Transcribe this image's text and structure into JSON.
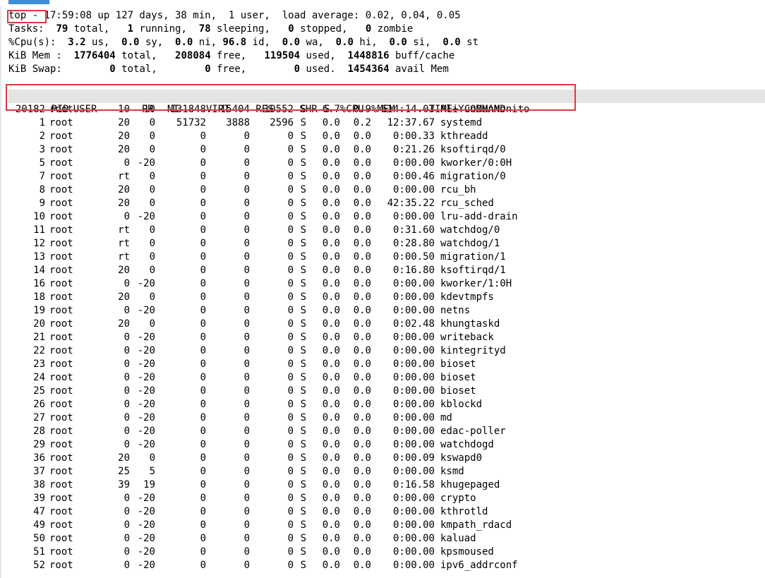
{
  "summary": {
    "l1": [
      "top - 17:59:08 up 127 days, 38 min,  1 user,  load average: 0.02, 0.04, 0.05"
    ],
    "tasks": {
      "label": "Tasks:",
      "total": "79",
      "total_l": " total,",
      "running": "1",
      "running_l": " running,",
      "sleeping": "78",
      "sleeping_l": " sleeping,",
      "stopped": "0",
      "stopped_l": " stopped,",
      "zombie": "0",
      "zombie_l": " zombie"
    },
    "cpu": {
      "label": "%Cpu(s):",
      "us": "3.2",
      "us_l": " us,",
      "sy": "0.0",
      "sy_l": " sy,",
      "ni": "0.0",
      "ni_l": " ni,",
      "id": "96.8",
      "id_l": " id,",
      "wa": "0.0",
      "wa_l": " wa,",
      "hi": "0.0",
      "hi_l": " hi,",
      "si": "0.0",
      "si_l": " si,",
      "st": "0.0",
      "st_l": " st"
    },
    "mem": {
      "label": "KiB Mem :",
      "total": "1776404",
      "total_l": " total,",
      "free": "208084",
      "free_l": " free,",
      "used": "119504",
      "used_l": " used,",
      "buff": "1448816",
      "buff_l": " buff/cache"
    },
    "swap": {
      "label": "KiB Swap:",
      "total": "0",
      "total_l": " total,",
      "free": "0",
      "free_l": " free,",
      "used": "0",
      "used_l": " used.",
      "avail": "1454364",
      "avail_l": " avail Mem"
    }
  },
  "columns": [
    "PID",
    "USER",
    "PR",
    "NI",
    "VIRT",
    "RES",
    "SHR",
    "S",
    "%CPU",
    "%MEM",
    "TIME+",
    "COMMAND"
  ],
  "processes": [
    [
      "20182",
      "root",
      "10",
      "10",
      "131848",
      "15404",
      "10552",
      "S",
      "6.7",
      "0.9",
      "614:14.03",
      "AliYunDunMonito"
    ],
    [
      "1",
      "root",
      "20",
      "0",
      "51732",
      "3888",
      "2596",
      "S",
      "0.0",
      "0.2",
      "12:37.67",
      "systemd"
    ],
    [
      "2",
      "root",
      "20",
      "0",
      "0",
      "0",
      "0",
      "S",
      "0.0",
      "0.0",
      "0:00.33",
      "kthreadd"
    ],
    [
      "3",
      "root",
      "20",
      "0",
      "0",
      "0",
      "0",
      "S",
      "0.0",
      "0.0",
      "0:21.26",
      "ksoftirqd/0"
    ],
    [
      "5",
      "root",
      "0",
      "-20",
      "0",
      "0",
      "0",
      "S",
      "0.0",
      "0.0",
      "0:00.00",
      "kworker/0:0H"
    ],
    [
      "7",
      "root",
      "rt",
      "0",
      "0",
      "0",
      "0",
      "S",
      "0.0",
      "0.0",
      "0:00.46",
      "migration/0"
    ],
    [
      "8",
      "root",
      "20",
      "0",
      "0",
      "0",
      "0",
      "S",
      "0.0",
      "0.0",
      "0:00.00",
      "rcu_bh"
    ],
    [
      "9",
      "root",
      "20",
      "0",
      "0",
      "0",
      "0",
      "S",
      "0.0",
      "0.0",
      "42:35.22",
      "rcu_sched"
    ],
    [
      "10",
      "root",
      "0",
      "-20",
      "0",
      "0",
      "0",
      "S",
      "0.0",
      "0.0",
      "0:00.00",
      "lru-add-drain"
    ],
    [
      "11",
      "root",
      "rt",
      "0",
      "0",
      "0",
      "0",
      "S",
      "0.0",
      "0.0",
      "0:31.60",
      "watchdog/0"
    ],
    [
      "12",
      "root",
      "rt",
      "0",
      "0",
      "0",
      "0",
      "S",
      "0.0",
      "0.0",
      "0:28.80",
      "watchdog/1"
    ],
    [
      "13",
      "root",
      "rt",
      "0",
      "0",
      "0",
      "0",
      "S",
      "0.0",
      "0.0",
      "0:00.50",
      "migration/1"
    ],
    [
      "14",
      "root",
      "20",
      "0",
      "0",
      "0",
      "0",
      "S",
      "0.0",
      "0.0",
      "0:16.80",
      "ksoftirqd/1"
    ],
    [
      "16",
      "root",
      "0",
      "-20",
      "0",
      "0",
      "0",
      "S",
      "0.0",
      "0.0",
      "0:00.00",
      "kworker/1:0H"
    ],
    [
      "18",
      "root",
      "20",
      "0",
      "0",
      "0",
      "0",
      "S",
      "0.0",
      "0.0",
      "0:00.00",
      "kdevtmpfs"
    ],
    [
      "19",
      "root",
      "0",
      "-20",
      "0",
      "0",
      "0",
      "S",
      "0.0",
      "0.0",
      "0:00.00",
      "netns"
    ],
    [
      "20",
      "root",
      "20",
      "0",
      "0",
      "0",
      "0",
      "S",
      "0.0",
      "0.0",
      "0:02.48",
      "khungtaskd"
    ],
    [
      "21",
      "root",
      "0",
      "-20",
      "0",
      "0",
      "0",
      "S",
      "0.0",
      "0.0",
      "0:00.00",
      "writeback"
    ],
    [
      "22",
      "root",
      "0",
      "-20",
      "0",
      "0",
      "0",
      "S",
      "0.0",
      "0.0",
      "0:00.00",
      "kintegrityd"
    ],
    [
      "23",
      "root",
      "0",
      "-20",
      "0",
      "0",
      "0",
      "S",
      "0.0",
      "0.0",
      "0:00.00",
      "bioset"
    ],
    [
      "24",
      "root",
      "0",
      "-20",
      "0",
      "0",
      "0",
      "S",
      "0.0",
      "0.0",
      "0:00.00",
      "bioset"
    ],
    [
      "25",
      "root",
      "0",
      "-20",
      "0",
      "0",
      "0",
      "S",
      "0.0",
      "0.0",
      "0:00.00",
      "bioset"
    ],
    [
      "26",
      "root",
      "0",
      "-20",
      "0",
      "0",
      "0",
      "S",
      "0.0",
      "0.0",
      "0:00.00",
      "kblockd"
    ],
    [
      "27",
      "root",
      "0",
      "-20",
      "0",
      "0",
      "0",
      "S",
      "0.0",
      "0.0",
      "0:00.00",
      "md"
    ],
    [
      "28",
      "root",
      "0",
      "-20",
      "0",
      "0",
      "0",
      "S",
      "0.0",
      "0.0",
      "0:00.00",
      "edac-poller"
    ],
    [
      "29",
      "root",
      "0",
      "-20",
      "0",
      "0",
      "0",
      "S",
      "0.0",
      "0.0",
      "0:00.00",
      "watchdogd"
    ],
    [
      "36",
      "root",
      "20",
      "0",
      "0",
      "0",
      "0",
      "S",
      "0.0",
      "0.0",
      "0:00.09",
      "kswapd0"
    ],
    [
      "37",
      "root",
      "25",
      "5",
      "0",
      "0",
      "0",
      "S",
      "0.0",
      "0.0",
      "0:00.00",
      "ksmd"
    ],
    [
      "38",
      "root",
      "39",
      "19",
      "0",
      "0",
      "0",
      "S",
      "0.0",
      "0.0",
      "0:16.58",
      "khugepaged"
    ],
    [
      "39",
      "root",
      "0",
      "-20",
      "0",
      "0",
      "0",
      "S",
      "0.0",
      "0.0",
      "0:00.00",
      "crypto"
    ],
    [
      "47",
      "root",
      "0",
      "-20",
      "0",
      "0",
      "0",
      "S",
      "0.0",
      "0.0",
      "0:00.00",
      "kthrotld"
    ],
    [
      "49",
      "root",
      "0",
      "-20",
      "0",
      "0",
      "0",
      "S",
      "0.0",
      "0.0",
      "0:00.00",
      "kmpath_rdacd"
    ],
    [
      "50",
      "root",
      "0",
      "-20",
      "0",
      "0",
      "0",
      "S",
      "0.0",
      "0.0",
      "0:00.00",
      "kaluad"
    ],
    [
      "51",
      "root",
      "0",
      "-20",
      "0",
      "0",
      "0",
      "S",
      "0.0",
      "0.0",
      "0:00.00",
      "kpsmoused"
    ],
    [
      "52",
      "root",
      "0",
      "-20",
      "0",
      "0",
      "0",
      "S",
      "0.0",
      "0.0",
      "0:00.00",
      "ipv6_addrconf"
    ]
  ],
  "colors": {
    "highlight": "#e0383e",
    "header_bg": "#e4e4e4",
    "tab_accent": "#3d8fd8"
  }
}
